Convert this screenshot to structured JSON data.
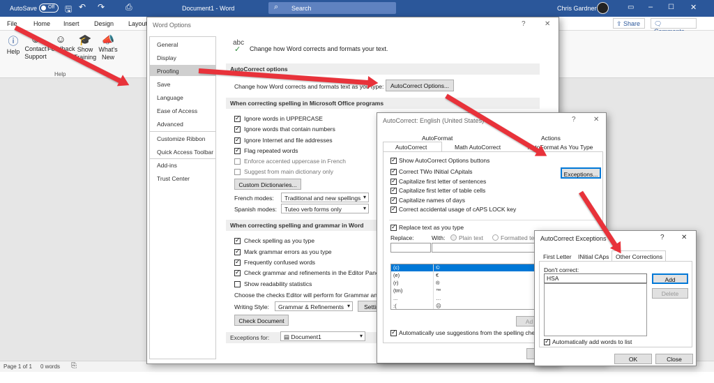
{
  "titlebar": {
    "autosave_label": "AutoSave",
    "autosave_state": "Off",
    "doc_title": "Document1  -  Word",
    "search_placeholder": "Search",
    "user_name": "Chris Gardner"
  },
  "ribbon": {
    "tabs": [
      "File",
      "Home",
      "Insert",
      "Design",
      "Layout"
    ],
    "share_label": "Share",
    "comments_label": "Comments",
    "buttons": [
      "Help",
      "Contact Support",
      "Feedback",
      "Show Training",
      "What's New"
    ],
    "group_label": "Help"
  },
  "statusbar": {
    "page": "Page 1 of 1",
    "words": "0 words"
  },
  "word_options": {
    "title": "Word Options",
    "help": "?",
    "close": "✕",
    "nav": [
      "General",
      "Display",
      "Proofing",
      "Save",
      "Language",
      "Ease of Access",
      "Advanced",
      "Customize Ribbon",
      "Quick Access Toolbar",
      "Add-ins",
      "Trust Center"
    ],
    "header_abc": "abc",
    "header_text": "Change how Word corrects and formats your text.",
    "sec_autocorrect": "AutoCorrect options",
    "autocorrect_desc": "Change how Word corrects and formats text as you type:",
    "autocorrect_btn": "AutoCorrect Options...",
    "sec_office": "When correcting spelling in Microsoft Office programs",
    "office_opts": [
      {
        "label": "Ignore words in UPPERCASE",
        "checked": true
      },
      {
        "label": "Ignore words that contain numbers",
        "checked": true
      },
      {
        "label": "Ignore Internet and file addresses",
        "checked": true
      },
      {
        "label": "Flag repeated words",
        "checked": true
      },
      {
        "label": "Enforce accented uppercase in French",
        "checked": false
      },
      {
        "label": "Suggest from main dictionary only",
        "checked": false
      }
    ],
    "custom_dict_btn": "Custom Dictionaries...",
    "french_label": "French modes:",
    "french_value": "Traditional and new spellings",
    "spanish_label": "Spanish modes:",
    "spanish_value": "Tuteo verb forms only",
    "sec_word": "When correcting spelling and grammar in Word",
    "word_opts": [
      {
        "label": "Check spelling as you type",
        "checked": true
      },
      {
        "label": "Mark grammar errors as you type",
        "checked": true
      },
      {
        "label": "Frequently confused words",
        "checked": true
      },
      {
        "label": "Check grammar and refinements in the Editor Pane",
        "checked": true
      },
      {
        "label": "Show readability statistics",
        "checked": false
      }
    ],
    "choose_text": "Choose the checks Editor will perform for Grammar and",
    "writing_style_label": "Writing Style:",
    "writing_style_value": "Grammar & Refinements",
    "settings_btn": "Settin",
    "check_doc_btn": "Check Document",
    "exceptions_label": "Exceptions for:",
    "exceptions_value": "Document1"
  },
  "autocorrect": {
    "title": "AutoCorrect: English (United States)",
    "help": "?",
    "close": "✕",
    "tabs_top": [
      "AutoFormat",
      "Actions"
    ],
    "tabs_bottom": [
      "AutoCorrect",
      "Math AutoCorrect",
      "AutoFormat As You Type"
    ],
    "opts": [
      {
        "label": "Show AutoCorrect Options buttons",
        "checked": true
      },
      {
        "label": "Correct TWo INitial CApitals",
        "checked": true
      },
      {
        "label": "Capitalize first letter of sentences",
        "checked": true
      },
      {
        "label": "Capitalize first letter of table cells",
        "checked": true
      },
      {
        "label": "Capitalize names of days",
        "checked": true
      },
      {
        "label": "Correct accidental usage of cAPS LOCK key",
        "checked": true
      }
    ],
    "exceptions_btn": "Exceptions...",
    "replace_label": "Replace text as you type",
    "replace_col": "Replace:",
    "with_col": "With:",
    "plain_text": "Plain text",
    "formatted_text": "Formatted text",
    "rows": [
      [
        "(c)",
        "©"
      ],
      [
        "(e)",
        "€"
      ],
      [
        "(r)",
        "®"
      ],
      [
        "(tm)",
        "™"
      ],
      [
        "...",
        "…"
      ],
      [
        ":(",
        "☹"
      ]
    ],
    "add_btn": "Ad",
    "auto_suggest": "Automatically use suggestions from the spelling check"
  },
  "exceptions": {
    "title": "AutoCorrect Exceptions",
    "help": "?",
    "close": "✕",
    "tabs": [
      "First Letter",
      "INitial CAps",
      "Other Corrections"
    ],
    "dont_correct": "Don't correct:",
    "input_value": "HSA",
    "add_btn": "Add",
    "delete_btn": "Delete",
    "auto_add": "Automatically add words to list",
    "ok": "OK",
    "close_btn": "Close"
  }
}
